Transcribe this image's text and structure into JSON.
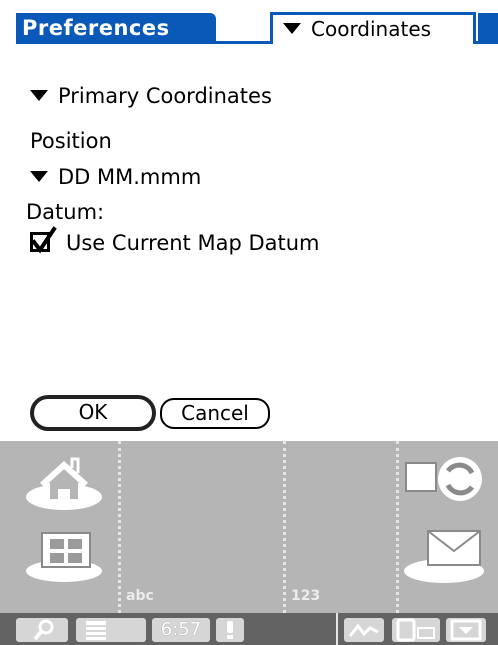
{
  "title_bar": {
    "title": "Preferences",
    "category_dropdown": "Coordinates"
  },
  "form": {
    "primary_dropdown": "Primary Coordinates",
    "position_label": "Position",
    "position_format": "DD MM.mmm",
    "datum_label": "Datum:",
    "use_map_datum": {
      "label": "Use Current Map Datum",
      "checked": true
    }
  },
  "buttons": {
    "ok": "OK",
    "cancel": "Cancel"
  },
  "graffiti": {
    "letters_label": "abc",
    "numbers_label": "123",
    "icons": [
      "home-icon",
      "find-icon",
      "favorites-icon",
      "sync-icon",
      "mail-icon"
    ]
  },
  "status_bar": {
    "time": "6:57",
    "icons": [
      "search-icon",
      "menu-icon",
      "alert-icon",
      "signal-icon",
      "rotate-icon",
      "input-area-icon"
    ]
  },
  "colors": {
    "accent": "#0a58b8",
    "silkscreen": "#b5b5b5",
    "statusbar": "#636363"
  }
}
